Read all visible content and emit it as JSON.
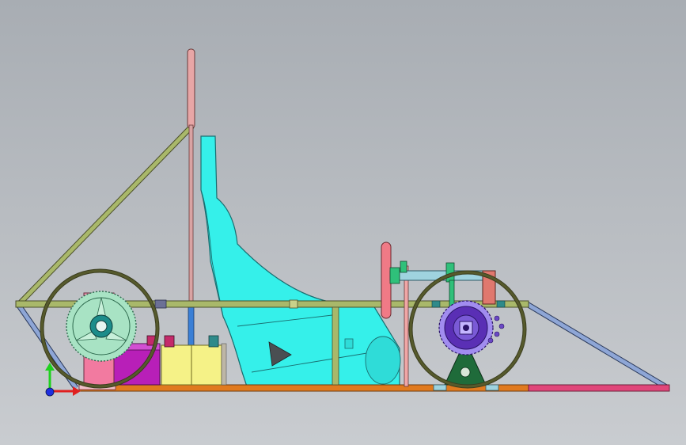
{
  "scene": {
    "background_top": "#a8adb3",
    "background_bottom": "#c9ccd0"
  },
  "colors": {
    "rail_olive": "#a9b86a",
    "rail_outline": "#4b4f2a",
    "front_strut_blue": "#8ea6d6",
    "rear_strut_blue": "#8ea6d6",
    "base_orange": "#e07a1f",
    "base_pink": "#e0467a",
    "pink_post": "#f0a6a6",
    "seat_cyan": "#35f0ea",
    "seat_cyan_dark": "#1fbfc0",
    "wheel_olive": "#565a2c",
    "sprocket_green": "#a8e3c4",
    "sprocket_hub": "#1c8c8a",
    "mount_pink": "#f29ab4",
    "battery_magenta": "#b81fb8",
    "battery_yellow": "#f5f287",
    "rear_sprocket_purple": "#5a2fb5",
    "rear_sprocket_light": "#a18cf0",
    "motor_mount_green": "#1f6b3a",
    "tiller_green": "#2fc07a",
    "tiller_blue": "#9fd3df",
    "rear_box_salmon": "#e0786e",
    "axis_x_red": "#e01f1f",
    "axis_y_green": "#1fd11f",
    "axis_origin_blue": "#1f2fe0"
  },
  "icons": {
    "coordinate_triad": "xyz-triad-icon"
  }
}
